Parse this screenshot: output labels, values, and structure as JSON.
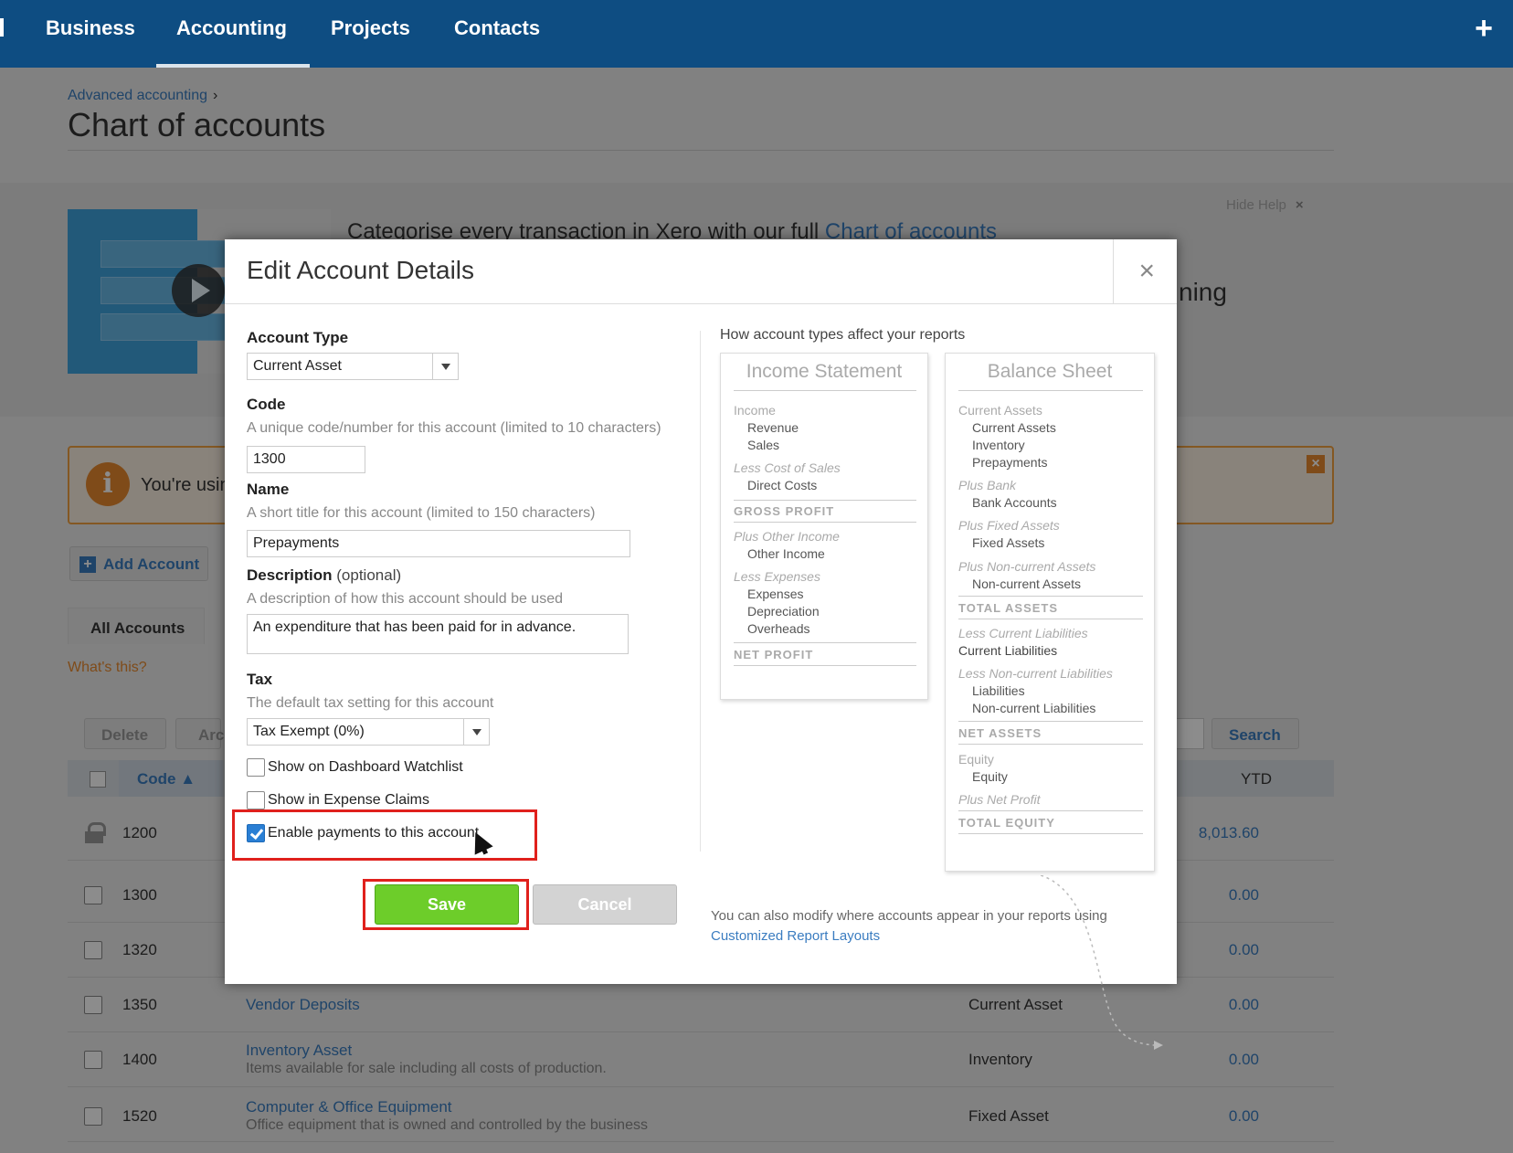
{
  "nav": {
    "items": [
      "Business",
      "Accounting",
      "Projects",
      "Contacts"
    ],
    "add_icon": "+"
  },
  "page": {
    "breadcrumb": "Advanced accounting",
    "breadcrumb_sep": "›",
    "title": "Chart of accounts",
    "help_heading_prefix": "Categorise every transaction in Xero with our full ",
    "help_heading_link": "Chart of accounts",
    "help_heading_tail": "ning",
    "hide_help": "Hide Help",
    "hide_help_x": "×",
    "notice_text": "You're usin",
    "notice_info": "i",
    "notice_close": "×",
    "add_account": "Add Account",
    "add_icon": "+",
    "tab_all": "All Accounts",
    "whats_this": "What's this?",
    "delete": "Delete",
    "archive": "Arc",
    "search": "Search",
    "col_code": "Code ▲",
    "col_ytd": "YTD",
    "rows": [
      {
        "code": "1200",
        "name": "",
        "desc": "",
        "type": "",
        "ytd": "8,013.60",
        "locked": true
      },
      {
        "code": "1300",
        "name": "",
        "desc": "",
        "type": "",
        "ytd": "0.00"
      },
      {
        "code": "1320",
        "name": "",
        "desc": "",
        "type": "",
        "ytd": "0.00"
      },
      {
        "code": "1350",
        "name": "Vendor Deposits",
        "desc": "",
        "type": "Current Asset",
        "ytd": "0.00"
      },
      {
        "code": "1400",
        "name": "Inventory Asset",
        "desc": "Items available for sale including all costs of production.",
        "type": "Inventory",
        "ytd": "0.00"
      },
      {
        "code": "1520",
        "name": "Computer & Office Equipment",
        "desc": "Office equipment that is owned and controlled by the business",
        "type": "Fixed Asset",
        "ytd": "0.00"
      }
    ]
  },
  "modal": {
    "title": "Edit Account Details",
    "close": "×",
    "account_type_label": "Account Type",
    "account_type_value": "Current Asset",
    "code_label": "Code",
    "code_hint": "A unique code/number for this account (limited to 10 characters)",
    "code_value": "1300",
    "name_label": "Name",
    "name_hint": "A short title for this account (limited to 150 characters)",
    "name_value": "Prepayments",
    "desc_label": "Description",
    "desc_optional": "(optional)",
    "desc_hint": "A description of how this account should be used",
    "desc_value": "An expenditure that has been paid for in advance.",
    "tax_label": "Tax",
    "tax_hint": "The default tax setting for this account",
    "tax_value": "Tax Exempt (0%)",
    "cb_watchlist": "Show on Dashboard Watchlist",
    "cb_expense": "Show in Expense Claims",
    "cb_payments": "Enable payments to this account",
    "save": "Save",
    "cancel": "Cancel",
    "diagram_title": "How account types affect your reports",
    "income_title": "Income Statement",
    "income_lines": [
      "Income",
      "Revenue",
      "Sales",
      "Less Cost of Sales",
      "Direct Costs",
      "GROSS PROFIT",
      "Plus Other Income",
      "Other Income",
      "Less Expenses",
      "Expenses",
      "Depreciation",
      "Overheads",
      "NET PROFIT"
    ],
    "balance_title": "Balance Sheet",
    "balance_lines": [
      "Current Assets",
      "Current Assets",
      "Inventory",
      "Prepayments",
      "Plus Bank",
      "Bank Accounts",
      "Plus Fixed Assets",
      "Fixed Assets",
      "Plus Non-current Assets",
      "Non-current Assets",
      "TOTAL ASSETS",
      "Less Current Liabilities",
      "Current Liabilities",
      "Less Non-current Liabilities",
      "Liabilities",
      "Non-current Liabilities",
      "NET ASSETS",
      "Equity",
      "Equity",
      "Plus Net Profit",
      "TOTAL EQUITY"
    ],
    "foot_text": "You can also modify where accounts appear in your reports using ",
    "foot_link": "Customized Report Layouts"
  },
  "colors": {
    "nav_bg": "#0e4d82",
    "link": "#3a7cc0",
    "save_green": "#6dcd2a",
    "highlight_red": "#e0201c",
    "notice_orange": "#e8892e"
  }
}
